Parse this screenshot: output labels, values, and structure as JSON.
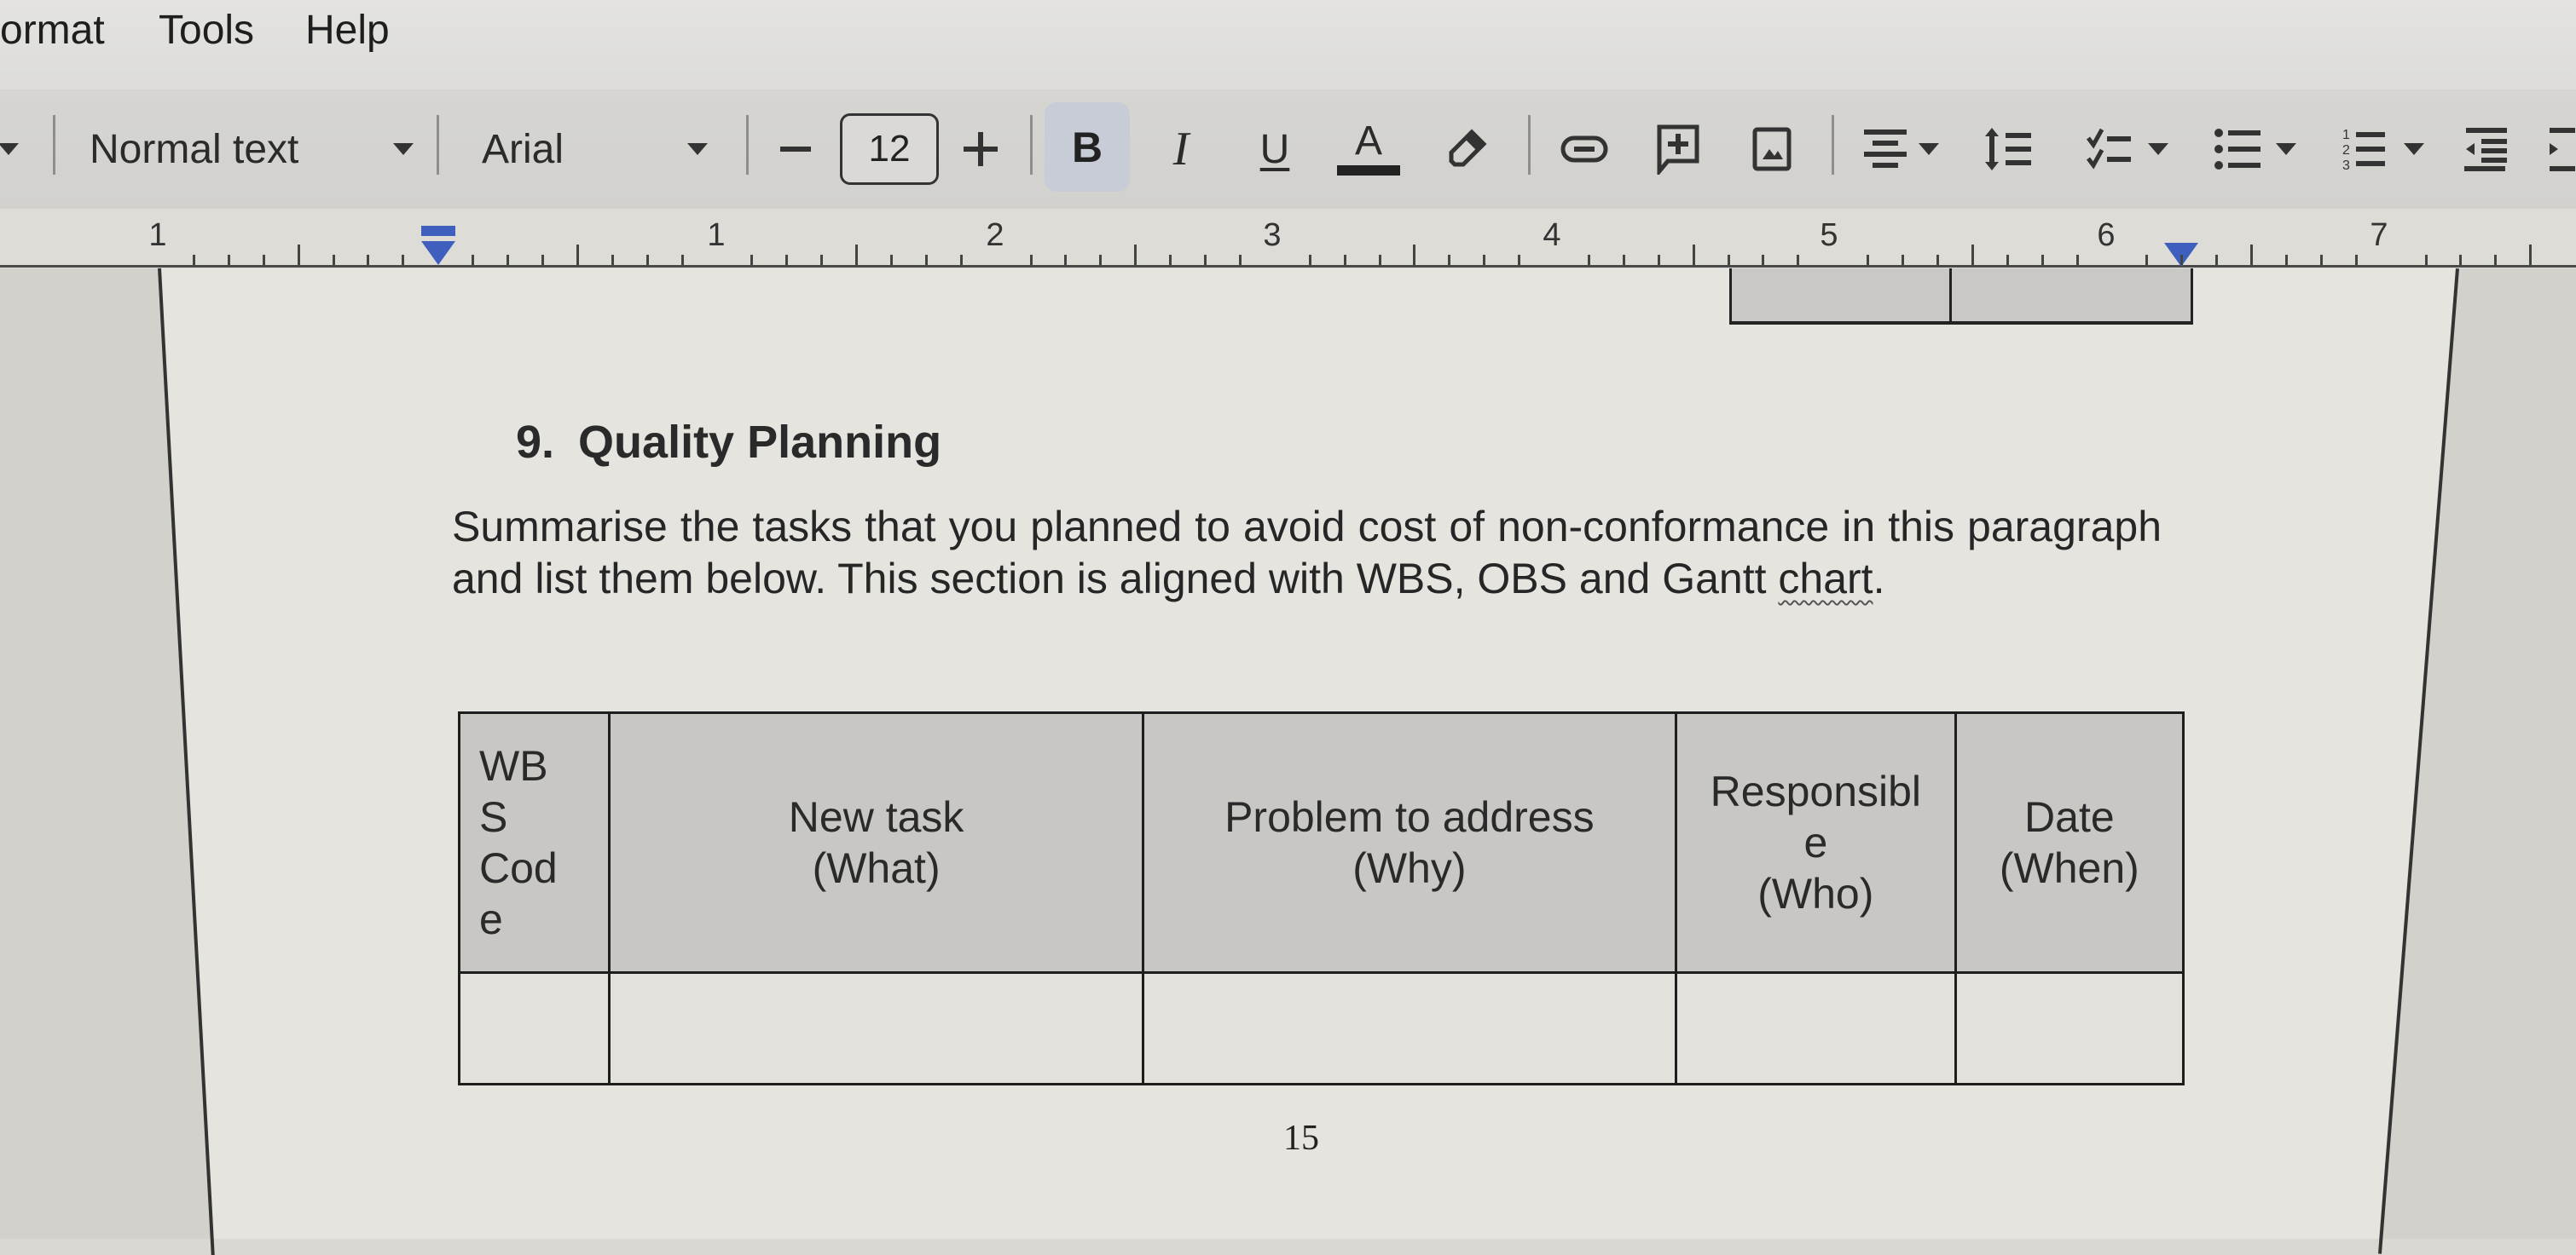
{
  "menu": {
    "items": [
      {
        "label": "ormat",
        "name": "menu-format"
      },
      {
        "label": "Tools",
        "name": "menu-tools"
      },
      {
        "label": "Help",
        "name": "menu-help"
      }
    ]
  },
  "toolbar": {
    "paragraph_style": "Normal text",
    "font_family": "Arial",
    "font_size": "12",
    "decrease_font_size_icon": "minus-icon",
    "increase_font_size_icon": "plus-icon",
    "bold_label": "B",
    "bold_active": true,
    "italic_label": "I",
    "underline_label": "U",
    "text_color_label": "A",
    "highlight_icon": "highlighter-icon",
    "link_icon": "link-icon",
    "comment_icon": "add-comment-icon",
    "image_icon": "insert-image-icon",
    "align_icon": "align-center-icon",
    "line_spacing_icon": "line-spacing-icon",
    "checklist_icon": "checklist-icon",
    "bullet_list_icon": "bulleted-list-icon",
    "numbered_list_icon": "numbered-list-icon",
    "decrease_indent_icon": "decrease-indent-icon",
    "increase_indent_icon": "increase-indent-icon",
    "active_color": "#c7ccd6"
  },
  "ruler": {
    "numbers": [
      "1",
      "1",
      "2",
      "3",
      "4",
      "5",
      "6",
      "7"
    ],
    "marker_color": "#3f5fbf"
  },
  "document": {
    "heading_number": "9.",
    "heading_text": "Quality Planning",
    "paragraph_main": "Summarise the tasks that you planned to avoid cost of non-conformance in this paragraph and list them below. This section is aligned with WBS, OBS and Gantt ",
    "paragraph_misspelled": "chart",
    "paragraph_end": ".",
    "table": {
      "headers": [
        {
          "lines": [
            "WB",
            "S",
            "Cod",
            "e"
          ]
        },
        {
          "lines": [
            "New task",
            "(What)"
          ]
        },
        {
          "lines": [
            "Problem to address",
            "(Why)"
          ]
        },
        {
          "lines": [
            "Responsibl",
            "e",
            "(Who)"
          ]
        },
        {
          "lines": [
            "Date",
            "(When)"
          ]
        }
      ],
      "rows": [
        [
          "",
          "",
          "",
          "",
          ""
        ]
      ]
    },
    "page_number": "15"
  }
}
